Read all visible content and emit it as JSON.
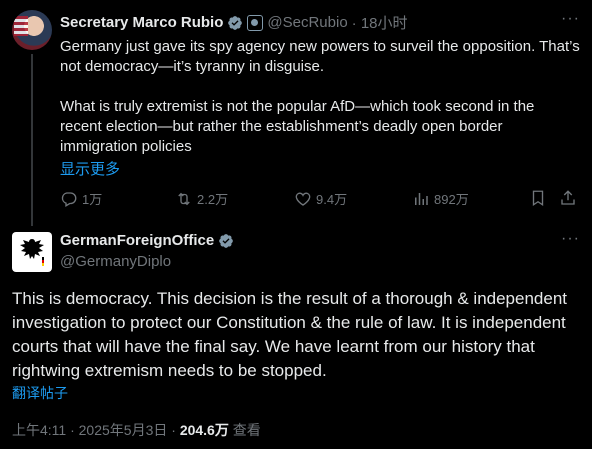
{
  "tweet": {
    "author_name": "Secretary Marco Rubio",
    "handle": "@SecRubio",
    "time": "· 18小时",
    "paragraph1": "Germany just gave its spy agency new powers to surveil the opposition. That’s not democracy—it’s tyranny in disguise.",
    "paragraph2": "What is truly extremist is not the popular AfD—which took second in the recent election—but rather the establishment’s deadly open border immigration policies",
    "show_more": "显示更多",
    "replies": "1万",
    "reposts": "2.2万",
    "likes": "9.4万",
    "views": "892万"
  },
  "reply": {
    "author_name": "GermanForeignOffice",
    "handle": "@GermanyDiplo",
    "text": "This is democracy. This decision is the result of a thorough & independent investigation to protect our Constitution & the rule of law. It is independent courts that will have the final say. We have learnt from our history that rightwing extremism needs to be stopped.",
    "translate": "翻译帖子",
    "timestamp": "上午4:11 · 2025年5月3日 · ",
    "view_count": "204.6万",
    "views_label": " 查看"
  },
  "colors": {
    "background": "#000000",
    "text": "#e7e9ea",
    "muted": "#71767b",
    "link": "#1d9bf0",
    "verified": "#829aab"
  },
  "icons": [
    "verified-badge-icon",
    "government-badge-icon",
    "more-icon",
    "reply-icon",
    "repost-icon",
    "like-icon",
    "views-icon",
    "bookmark-icon",
    "share-icon",
    "eagle-icon"
  ]
}
